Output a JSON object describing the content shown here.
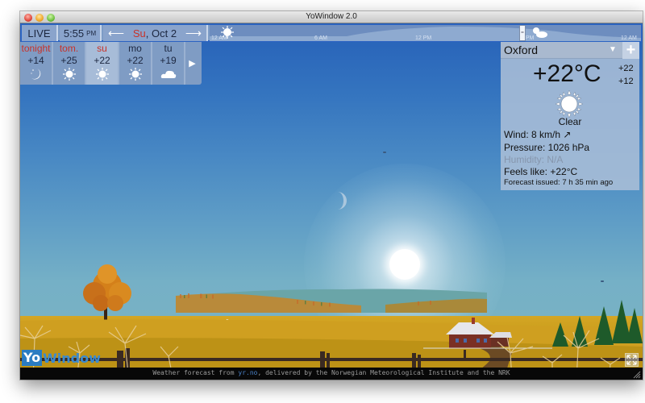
{
  "window": {
    "title": "YoWindow 2.0"
  },
  "timeline": {
    "live_label": "LIVE",
    "time": "5:55",
    "time_suffix": "PM",
    "date_day": "Su",
    "date_rest": ", Oct 2",
    "prev_arrow": "⟵",
    "next_arrow": "⟶",
    "ticks": [
      "12 AM",
      "6 AM",
      "12 PM",
      "6 PM",
      "12 AM"
    ],
    "handle_label": "="
  },
  "forecast": {
    "days": [
      {
        "label": "tonight",
        "temp": "+14",
        "icon": "moon-icon",
        "red": true,
        "selected": false
      },
      {
        "label": "tom.",
        "temp": "+25",
        "icon": "sun-icon",
        "red": true,
        "selected": false
      },
      {
        "label": "su",
        "temp": "+22",
        "icon": "sun-icon",
        "red": true,
        "selected": true
      },
      {
        "label": "mo",
        "temp": "+22",
        "icon": "sun-icon",
        "red": false,
        "selected": false
      },
      {
        "label": "tu",
        "temp": "+19",
        "icon": "cloud-icon",
        "red": false,
        "selected": false
      }
    ],
    "next_arrow": "▶"
  },
  "current": {
    "city": "Oxford",
    "dropdown_glyph": "▼",
    "add_label": "+",
    "temperature": "+22°C",
    "high": "+22",
    "low": "+12",
    "condition": "Clear",
    "wind": "Wind:  8 km/h  ↗",
    "pressure": "Pressure:  1026 hPa",
    "humidity": "Humidity:  N/A",
    "feels_like": "Feels like:  +22°C",
    "forecast_issued": "Forecast issued:  7 h 35 min ago"
  },
  "branding": {
    "yo": "Yo",
    "window": "Window"
  },
  "status": {
    "prefix": "Weather forecast from ",
    "link": "yr.no",
    "suffix": ", delivered by the Norwegian Meteorological Institute and the NRK"
  },
  "colors": {
    "accent_red": "#c8332a",
    "sky_top": "#2660b8",
    "panel": "#aabed7",
    "link_blue": "#4a82c8"
  }
}
